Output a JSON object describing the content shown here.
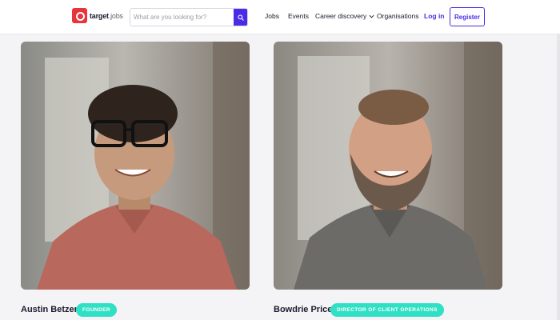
{
  "header": {
    "logo": {
      "name": "target",
      "suffix": "jobs"
    },
    "search": {
      "placeholder": "What are you looking for?"
    },
    "nav": {
      "jobs": "Jobs",
      "events": "Events",
      "career_discovery": "Career discovery",
      "organisations": "Organisations",
      "login": "Log in",
      "register": "Register"
    }
  },
  "team": [
    {
      "name": "Austin Betzer",
      "role": "FOUNDER"
    },
    {
      "name": "Bowdrie Price",
      "role": "DIRECTOR OF CLIENT OPERATIONS"
    }
  ],
  "colors": {
    "brand": "#4a2ce8",
    "logo_red": "#e9343b",
    "badge": "#2fe0c4"
  }
}
